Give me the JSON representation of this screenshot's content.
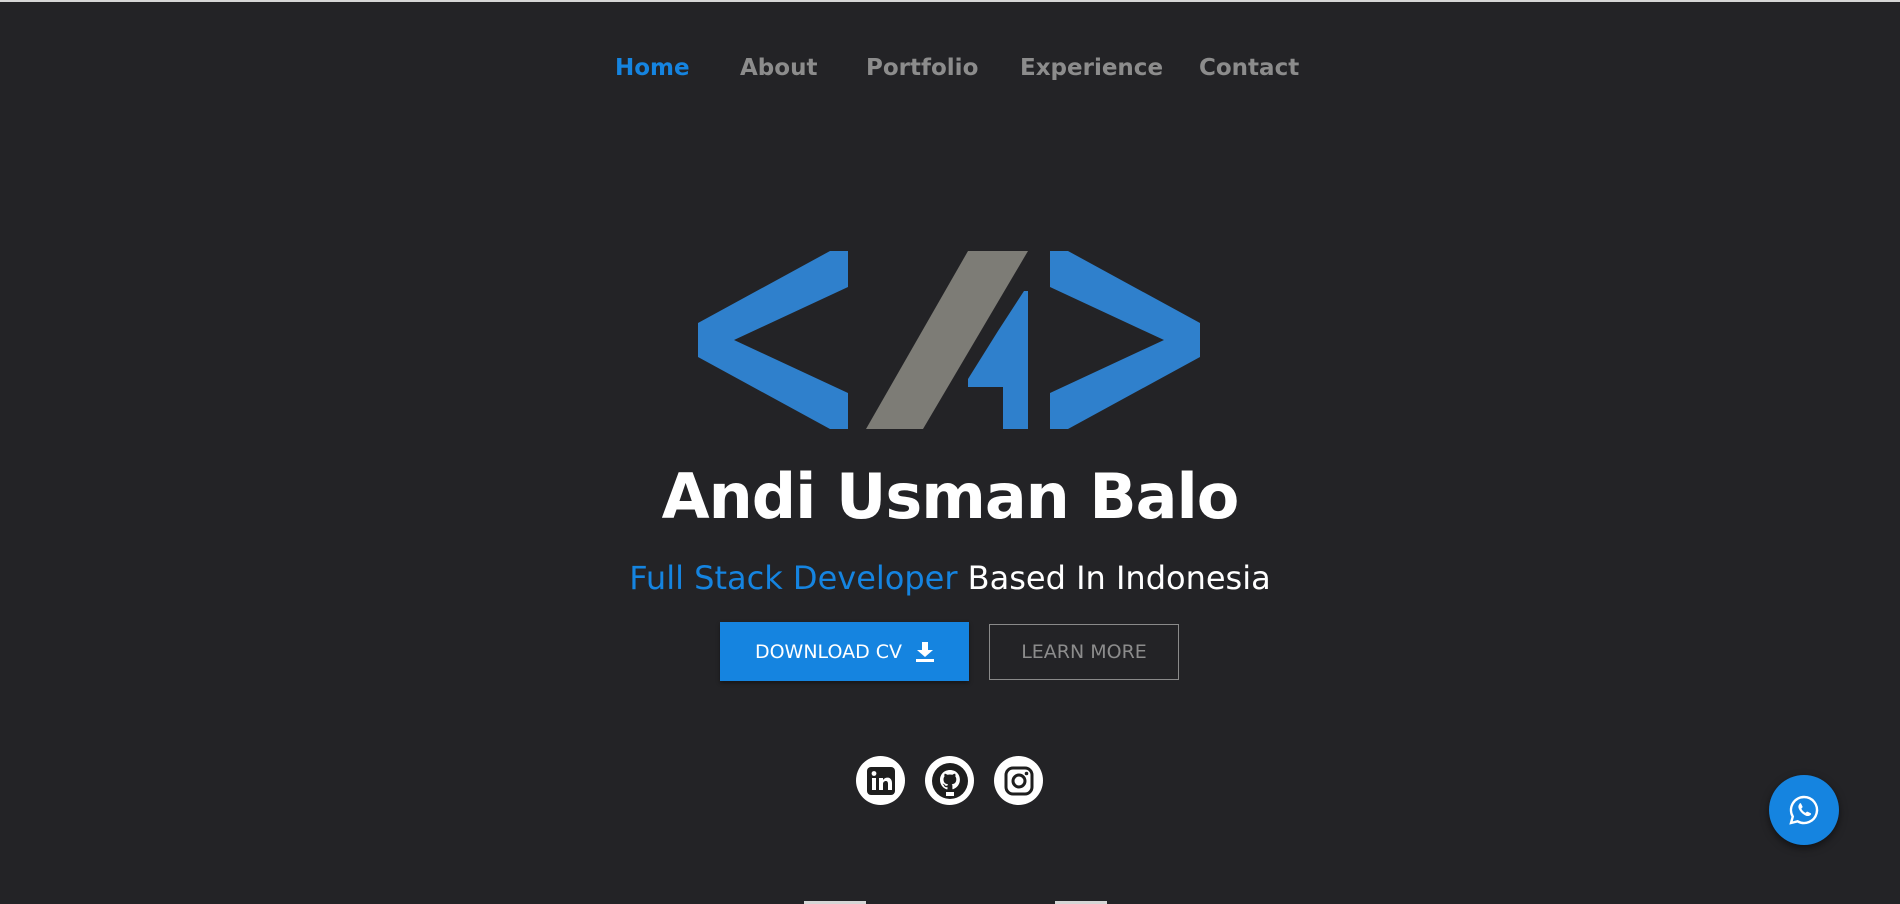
{
  "nav": {
    "items": [
      {
        "label": "Home",
        "active": true
      },
      {
        "label": "About",
        "active": false
      },
      {
        "label": "Portfolio",
        "active": false
      },
      {
        "label": "Experience",
        "active": false
      },
      {
        "label": "Contact",
        "active": false
      }
    ]
  },
  "hero": {
    "logo_icon": "code-brackets-logo-icon",
    "name": "Andi Usman Balo",
    "role": "Full Stack Developer",
    "location_text": " Based In Indonesia"
  },
  "buttons": {
    "download_label": "DOWNLOAD CV",
    "download_icon": "download-icon",
    "learn_more_label": "LEARN MORE"
  },
  "social": [
    {
      "icon": "linkedin-icon"
    },
    {
      "icon": "github-icon"
    },
    {
      "icon": "instagram-icon"
    }
  ],
  "floating": {
    "icon": "whatsapp-icon"
  },
  "colors": {
    "background": "#232326",
    "accent": "#1584e0",
    "nav_inactive": "#8c8c8c",
    "logo_blue": "#2f80cc",
    "logo_gray": "#7d7c76",
    "text": "#ffffff"
  }
}
